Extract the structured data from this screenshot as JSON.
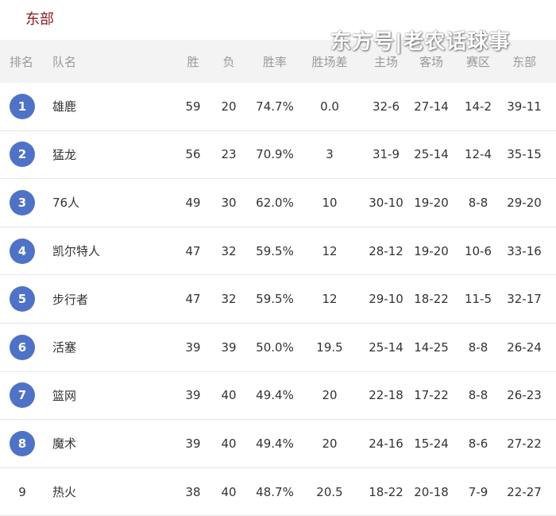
{
  "page": {
    "title": "东部",
    "watermark": "东方号|老农话球事"
  },
  "table": {
    "headers": {
      "rank": "排名",
      "team": "队名",
      "wins": "胜",
      "losses": "负",
      "pct": "胜率",
      "gb": "胜场差",
      "home": "主场",
      "away": "客场",
      "division": "赛区",
      "conference": "东部"
    },
    "rows": [
      {
        "rank": "1",
        "team": "雄鹿",
        "wins": "59",
        "losses": "20",
        "pct": "74.7%",
        "gb": "0.0",
        "home": "32-6",
        "away": "27-14",
        "division": "14-2",
        "conference": "39-11"
      },
      {
        "rank": "2",
        "team": "猛龙",
        "wins": "56",
        "losses": "23",
        "pct": "70.9%",
        "gb": "3",
        "home": "31-9",
        "away": "25-14",
        "division": "12-4",
        "conference": "35-15"
      },
      {
        "rank": "3",
        "team": "76人",
        "wins": "49",
        "losses": "30",
        "pct": "62.0%",
        "gb": "10",
        "home": "30-10",
        "away": "19-20",
        "division": "8-8",
        "conference": "29-20"
      },
      {
        "rank": "4",
        "team": "凯尔特人",
        "wins": "47",
        "losses": "32",
        "pct": "59.5%",
        "gb": "12",
        "home": "28-12",
        "away": "19-20",
        "division": "10-6",
        "conference": "33-16"
      },
      {
        "rank": "5",
        "team": "步行者",
        "wins": "47",
        "losses": "32",
        "pct": "59.5%",
        "gb": "12",
        "home": "29-10",
        "away": "18-22",
        "division": "11-5",
        "conference": "32-17"
      },
      {
        "rank": "6",
        "team": "活塞",
        "wins": "39",
        "losses": "39",
        "pct": "50.0%",
        "gb": "19.5",
        "home": "25-14",
        "away": "14-25",
        "division": "8-8",
        "conference": "26-24"
      },
      {
        "rank": "7",
        "team": "篮网",
        "wins": "39",
        "losses": "40",
        "pct": "49.4%",
        "gb": "20",
        "home": "22-18",
        "away": "17-22",
        "division": "8-8",
        "conference": "26-23"
      },
      {
        "rank": "8",
        "team": "魔术",
        "wins": "39",
        "losses": "40",
        "pct": "49.4%",
        "gb": "20",
        "home": "24-16",
        "away": "15-24",
        "division": "8-6",
        "conference": "27-22"
      },
      {
        "rank": "9",
        "team": "热火",
        "wins": "38",
        "losses": "40",
        "pct": "48.7%",
        "gb": "20.5",
        "home": "18-22",
        "away": "20-18",
        "division": "7-9",
        "conference": "22-27"
      }
    ]
  },
  "colors": {
    "title": "#8b1a1a",
    "rank_badge": "#4e72c7",
    "header_bg": "#f3f3f3",
    "header_text": "#999999"
  }
}
